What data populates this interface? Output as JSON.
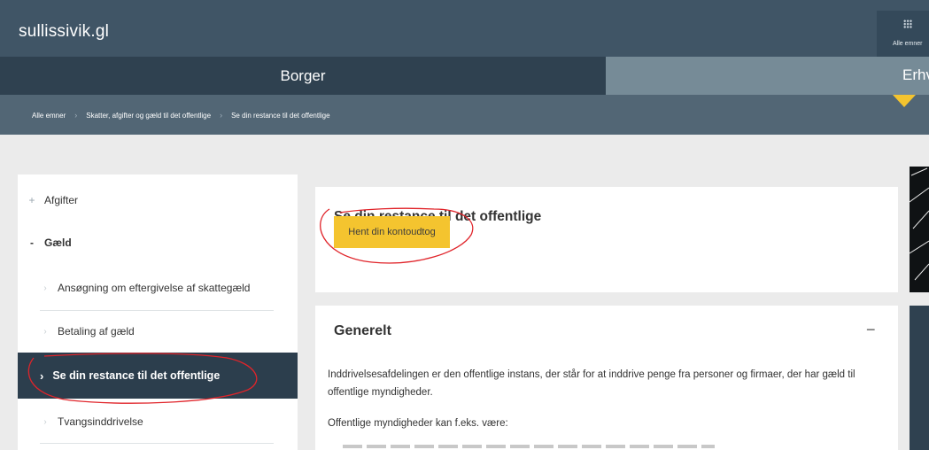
{
  "header": {
    "site_name": "sullissivik.gl",
    "alle_emner": "Alle emner"
  },
  "tabs": [
    {
      "label": "Borger",
      "active": true
    },
    {
      "label": "Erhverv",
      "active": false
    }
  ],
  "breadcrumb": [
    "Alle emner",
    "Skatter, afgifter og gæld til det offentlige",
    "Se din restance til det offentlige"
  ],
  "sidebar": {
    "items": [
      {
        "label": "Afgifter",
        "expanded": false
      },
      {
        "label": "Gæld",
        "expanded": true
      },
      {
        "label": "Ansøgning om eftergivelse af skattegæld"
      },
      {
        "label": "Betaling af gæld"
      },
      {
        "label": "Se din restance til det offentlige",
        "active": true
      },
      {
        "label": "Tvangsinddrivelse"
      }
    ]
  },
  "main": {
    "title": "Se din restance til det offentlige",
    "button_label": "Hent din kontoudtog",
    "section": {
      "title": "Generelt",
      "paragraph1": "Inddrivelsesafdelingen er den offentlige instans, der står for at inddrive penge fra personer og firmaer, der har gæld til offentlige myndigheder.",
      "paragraph2": "Offentlige myndigheder kan f.eks. være:"
    }
  },
  "colors": {
    "header_bg": "#405566",
    "tab_active": "#2f4150",
    "tab_inactive": "#768b97",
    "breadcrumb_bg": "#526675",
    "accent": "#f4c42f",
    "annotation": "#e0242a"
  }
}
